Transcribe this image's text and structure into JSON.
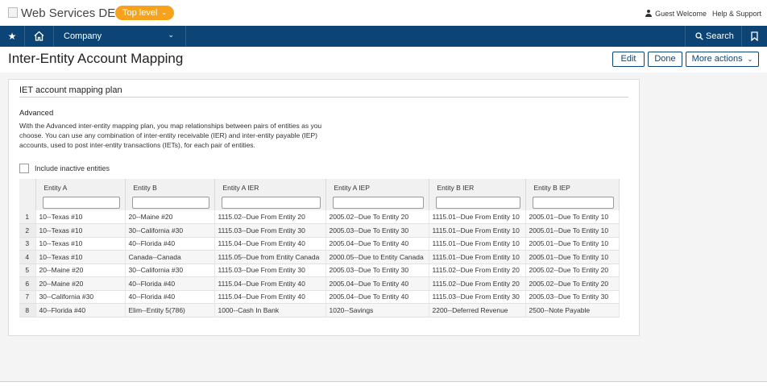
{
  "header": {
    "company_name": "Web Services DEMO",
    "entity_selector": "Top level",
    "user": "Guest Welcome",
    "help": "Help & Support"
  },
  "nav": {
    "module": "Company",
    "search": "Search"
  },
  "page": {
    "title": "Inter-Entity Account Mapping",
    "buttons": {
      "edit": "Edit",
      "done": "Done",
      "more": "More actions"
    }
  },
  "panel": {
    "title": "IET account mapping plan",
    "plan_name": "Advanced",
    "plan_description": "With the Advanced inter-entity mapping plan, you map relationships between pairs of entities as you choose. You can use any combination of inter-entity receivable (IER) and inter-entity payable (IEP) accounts, used to post inter-entity transactions (IETs), for each pair of entities.",
    "include_inactive_label": "Include inactive entities",
    "include_inactive_checked": false
  },
  "table": {
    "columns": [
      "Entity A",
      "Entity B",
      "Entity A IER",
      "Entity A IEP",
      "Entity B IER",
      "Entity B IEP"
    ],
    "rows": [
      [
        "1",
        "10--Texas #10",
        "20--Maine #20",
        "1115.02--Due From Entity 20",
        "2005.02--Due To Entity 20",
        "1115.01--Due From Entity 10",
        "2005.01--Due To Entity 10"
      ],
      [
        "2",
        "10--Texas #10",
        "30--California #30",
        "1115.03--Due From Entity 30",
        "2005.03--Due To Entity 30",
        "1115.01--Due From Entity 10",
        "2005.01--Due To Entity 10"
      ],
      [
        "3",
        "10--Texas #10",
        "40--Florida #40",
        "1115.04--Due From Entity 40",
        "2005.04--Due To Entity 40",
        "1115.01--Due From Entity 10",
        "2005.01--Due To Entity 10"
      ],
      [
        "4",
        "10--Texas #10",
        "Canada--Canada",
        "1115.05--Due from Entity Canada",
        "2000.05--Due to Entity Canada",
        "1115.01--Due From Entity 10",
        "2005.01--Due To Entity 10"
      ],
      [
        "5",
        "20--Maine #20",
        "30--California #30",
        "1115.03--Due From Entity 30",
        "2005.03--Due To Entity 30",
        "1115.02--Due From Entity 20",
        "2005.02--Due To Entity 20"
      ],
      [
        "6",
        "20--Maine #20",
        "40--Florida #40",
        "1115.04--Due From Entity 40",
        "2005.04--Due To Entity 40",
        "1115.02--Due From Entity 20",
        "2005.02--Due To Entity 20"
      ],
      [
        "7",
        "30--California #30",
        "40--Florida #40",
        "1115.04--Due From Entity 40",
        "2005.04--Due To Entity 40",
        "1115.03--Due From Entity 30",
        "2005.03--Due To Entity 30"
      ],
      [
        "8",
        "40--Florida #40",
        "Elim--Entity 5(786)",
        "1000--Cash In Bank",
        "1020--Savings",
        "2200--Deferred Revenue",
        "2500--Note Payable"
      ]
    ]
  },
  "colors": {
    "nav_background": "#0c4575",
    "badge_background": "#f7a21c"
  },
  "icons": [
    "star-icon",
    "home-icon",
    "chevron-down-icon",
    "search-icon",
    "bookmark-icon",
    "user-icon"
  ]
}
